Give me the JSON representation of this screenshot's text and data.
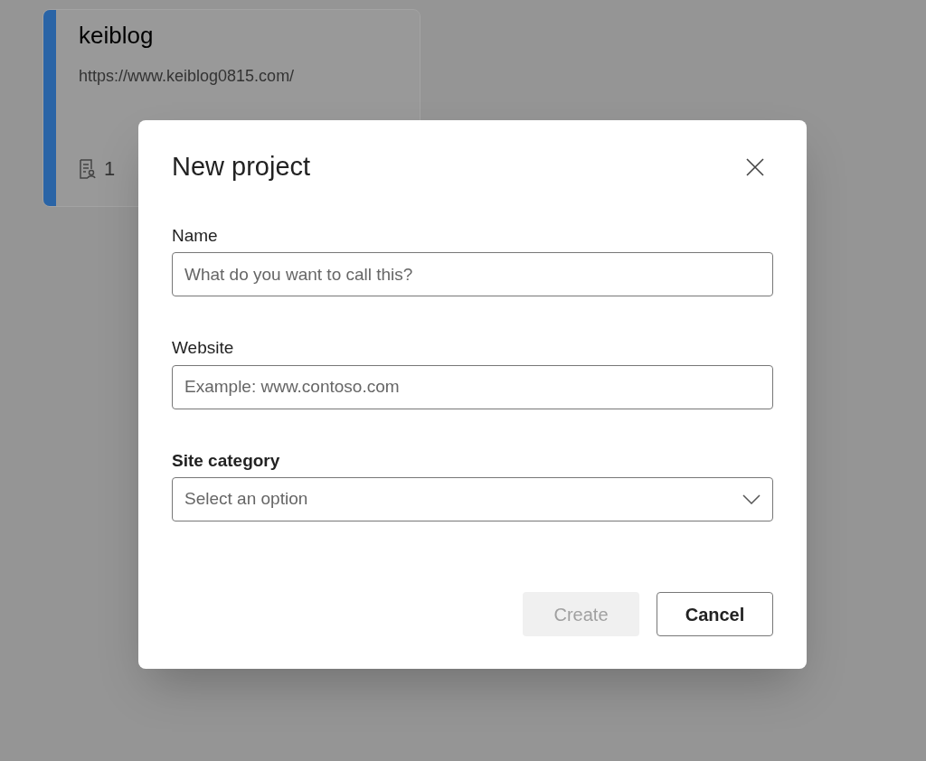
{
  "project_card": {
    "title": "keiblog",
    "url": "https://www.keiblog0815.com/",
    "count": "1"
  },
  "dialog": {
    "title": "New project",
    "fields": [
      {
        "kind": "text",
        "label": "Name",
        "placeholder": "What do you want to call this?"
      },
      {
        "kind": "text",
        "label": "Website",
        "placeholder": "Example: www.contoso.com"
      },
      {
        "kind": "select",
        "label": "Site category",
        "placeholder": "Select an option"
      }
    ],
    "buttons": [
      {
        "label": "Create",
        "disabled": true
      },
      {
        "label": "Cancel",
        "disabled": false
      }
    ]
  }
}
